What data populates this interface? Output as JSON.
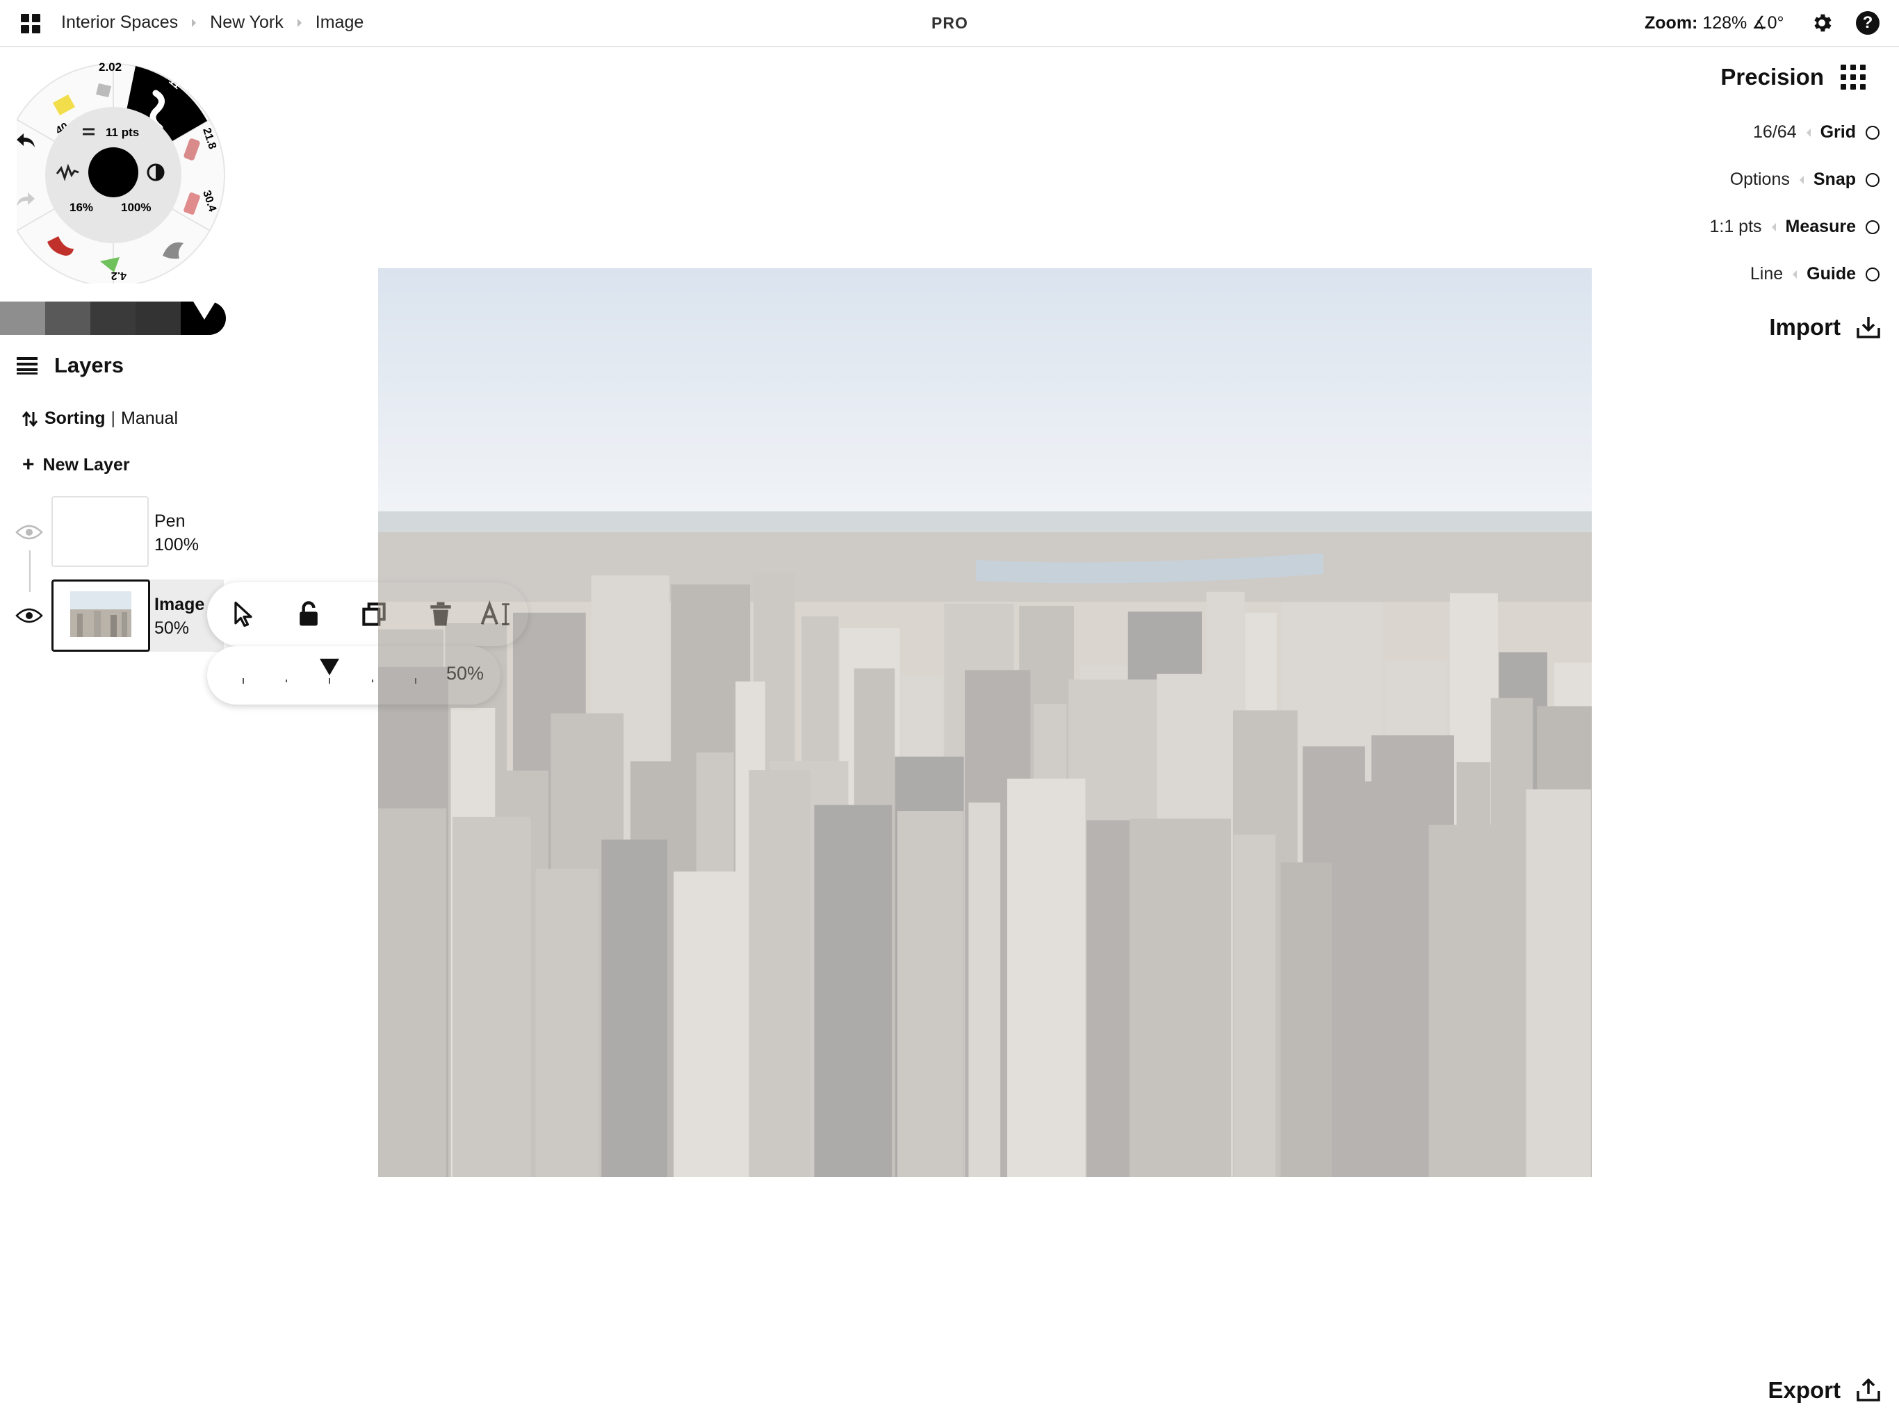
{
  "breadcrumb": [
    "Interior Spaces",
    "New York",
    "Image"
  ],
  "badge": "PRO",
  "zoom": {
    "label": "Zoom:",
    "value": "128% ∡0°"
  },
  "brush": {
    "size_label": "11 pts",
    "smoothing": "16%",
    "opacity": "100%",
    "presets": [
      "40",
      "2.02",
      "11",
      "21.8",
      "30.4",
      "4.2"
    ]
  },
  "colors": [
    "#8e8e8e",
    "#595959",
    "#3a3a3a",
    "#333333",
    "#000000"
  ],
  "layers": {
    "title": "Layers",
    "sorting_label": "Sorting",
    "sorting_value": "Manual",
    "new_layer": "New Layer",
    "items": [
      {
        "name": "Pen",
        "opacity": "100%"
      },
      {
        "name": "Image",
        "opacity": "50%"
      }
    ]
  },
  "layer_opacity": {
    "value": "50%",
    "level": 0.5
  },
  "precision": {
    "title": "Precision",
    "rows": [
      {
        "value": "16/64",
        "label": "Grid"
      },
      {
        "value": "Options",
        "label": "Snap"
      },
      {
        "value": "1:1 pts",
        "label": "Measure"
      },
      {
        "value": "Line",
        "label": "Guide"
      }
    ]
  },
  "import_label": "Import",
  "export_label": "Export"
}
